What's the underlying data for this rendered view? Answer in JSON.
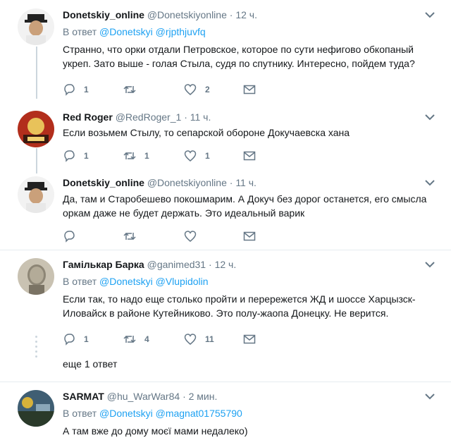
{
  "tweets": [
    {
      "name": "Donetskiy_online",
      "handle": "@Donetskiyonline",
      "dot": "·",
      "time": "12 ч.",
      "reply_prefix": "В ответ",
      "reply_to": "@Donetskyi @rjpthjuvfq",
      "text": "Странно, что орки отдали Петровское, которое по сути нефигово обкопаный укреп. Зато выше - голая Стыла, судя по спутнику. Интересно, пойдем туда?",
      "replies": "1",
      "retweets": "",
      "likes": "2"
    },
    {
      "name": "Red Roger",
      "handle": "@RedRoger_1",
      "dot": "·",
      "time": "11 ч.",
      "text": "Если возьмем Стылу, то сепарской обороне Докучаевска хана",
      "replies": "1",
      "retweets": "1",
      "likes": "1"
    },
    {
      "name": "Donetskiy_online",
      "handle": "@Donetskiyonline",
      "dot": "·",
      "time": "11 ч.",
      "text": "Да, там и Старобешево покошмарим. А Докуч без дорог останется, его смысла оркам даже не будет держать. Это идеальный варик",
      "replies": "",
      "retweets": "",
      "likes": ""
    },
    {
      "name": "Гамількар Барка",
      "handle": "@ganimed31",
      "dot": "·",
      "time": "12 ч.",
      "reply_prefix": "В ответ",
      "reply_to": "@Donetskyi @Vlupidolin",
      "text": "Если так, то надо еще столько пройти и перережется ЖД и шоссе Харцызск-Иловайск в районе Кутейниково. Это полу-жаопа Донецку. Не верится.",
      "replies": "1",
      "retweets": "4",
      "likes": "11"
    },
    {
      "name": "SARMAT",
      "handle": "@hu_WarWar84",
      "dot": "·",
      "time": "2 мин.",
      "reply_prefix": "В ответ",
      "reply_to": "@Donetskyi @magnat01755790",
      "text": "А там вже до дому моєї мами недалеко)"
    }
  ],
  "more_replies": "еще 1 ответ",
  "colors": {
    "accent": "#1da1f2",
    "muted": "#657786",
    "line": "#ccd6dd"
  },
  "icons": [
    "reply-icon",
    "retweet-icon",
    "like-icon",
    "dm-icon",
    "caret-down-icon"
  ]
}
